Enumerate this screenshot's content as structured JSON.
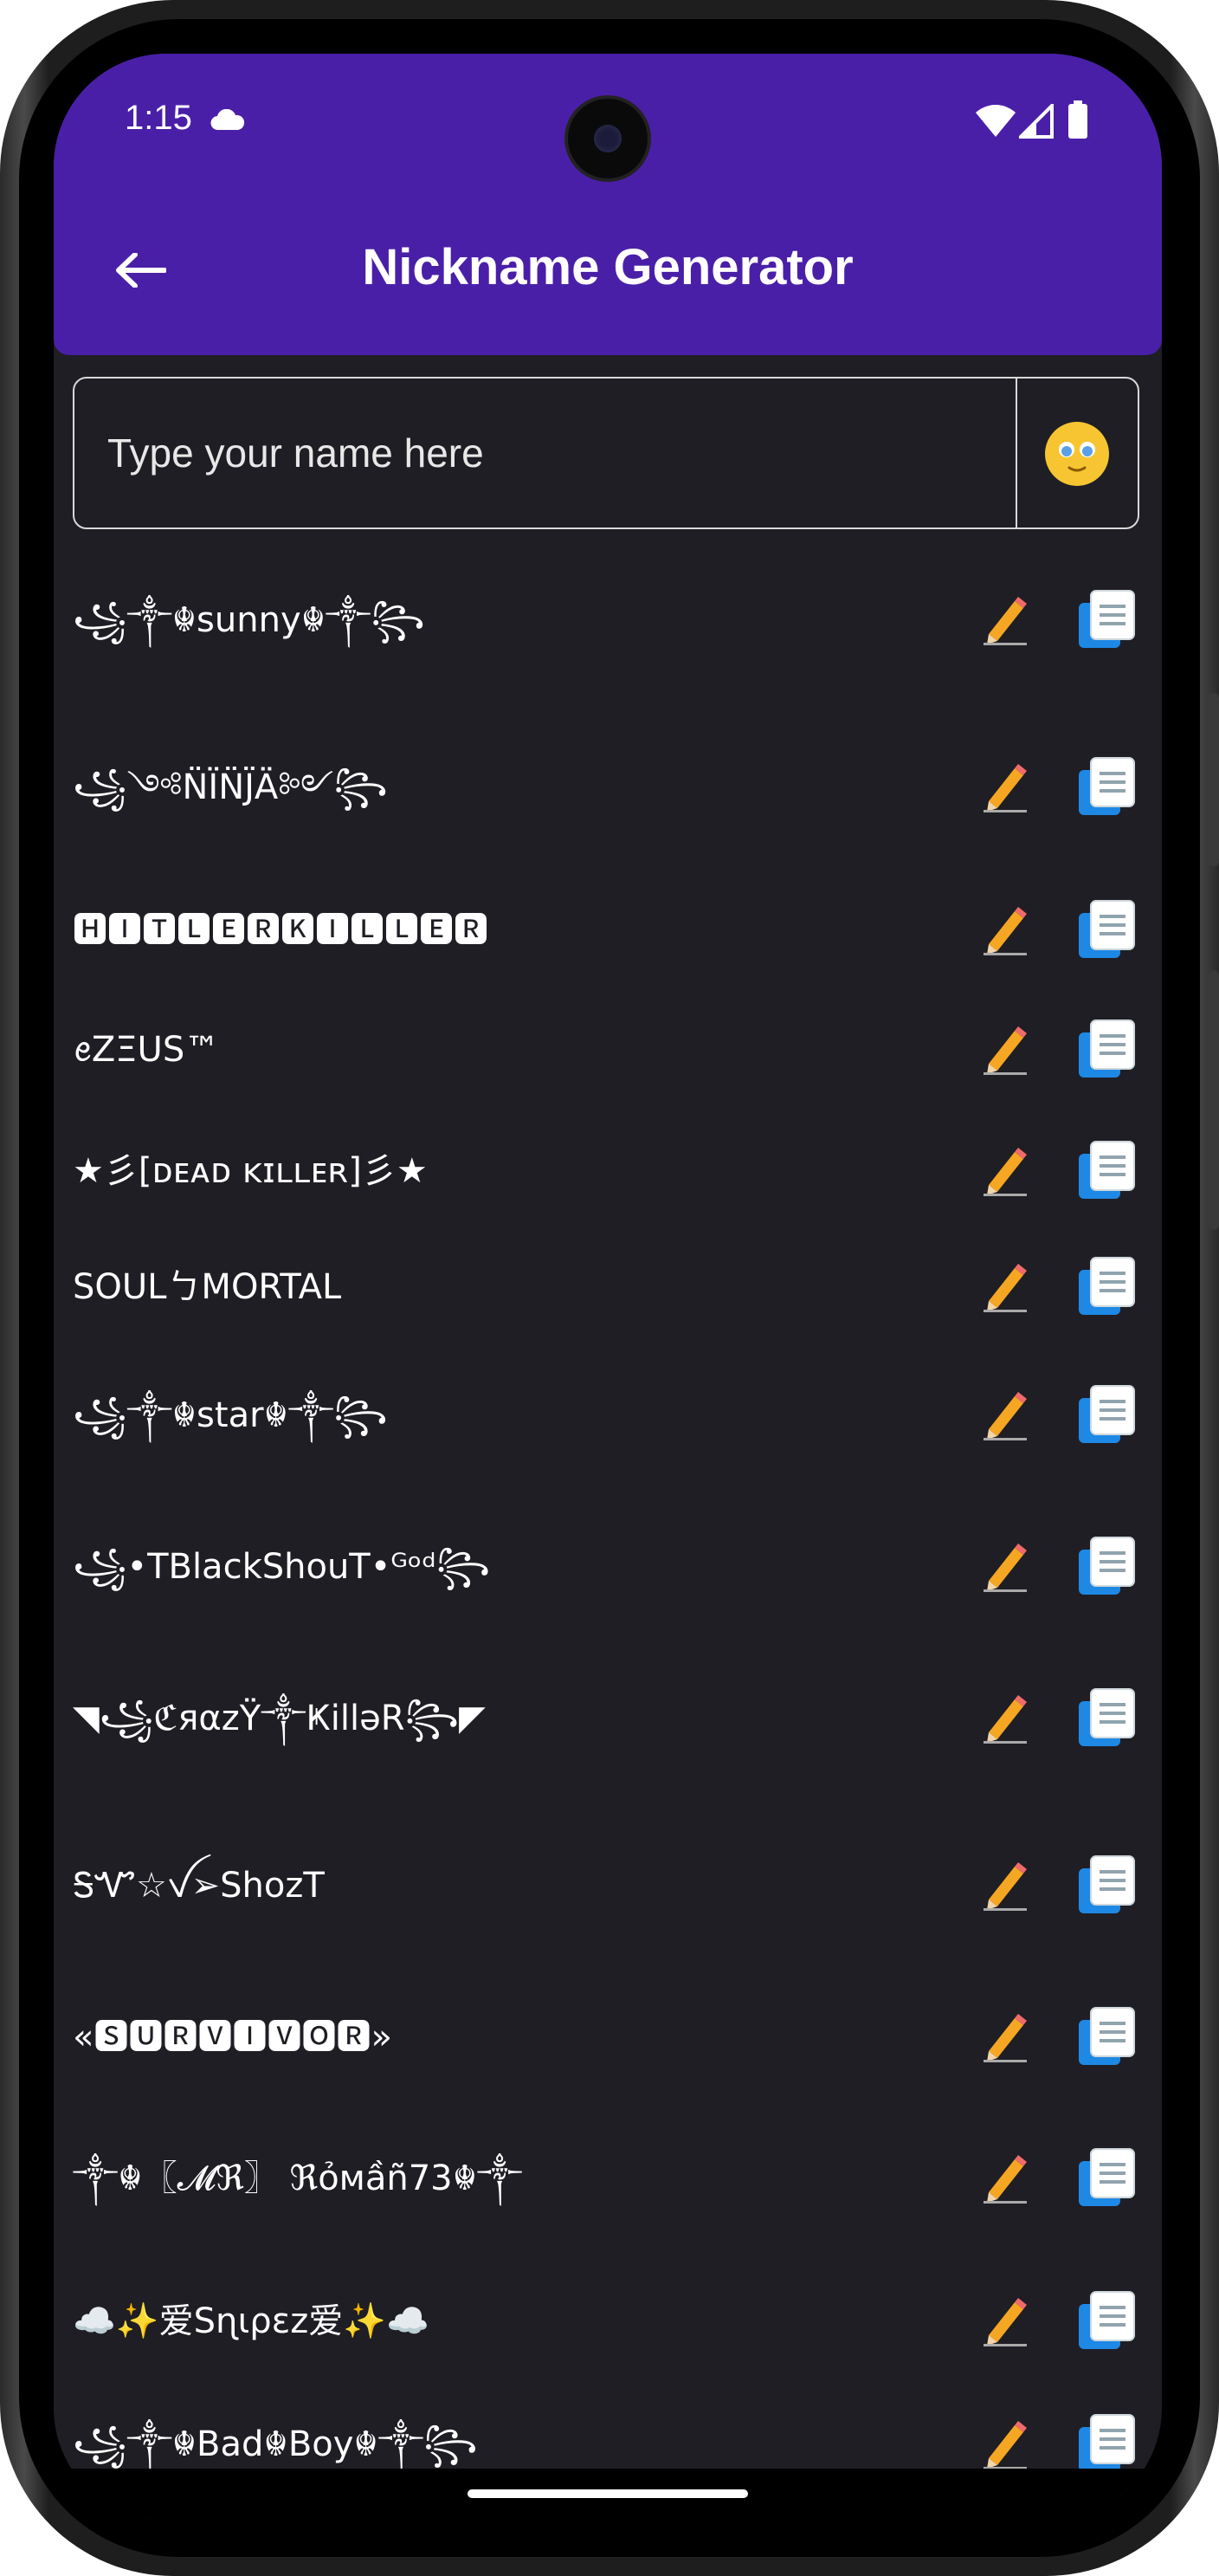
{
  "status_bar": {
    "time": "1:15",
    "icons": [
      "cloud-icon",
      "wifi-icon",
      "signal-icon",
      "battery-icon"
    ]
  },
  "app_bar": {
    "title": "Nickname Generator",
    "back_icon": "arrow-left-icon",
    "background": "#4a1fa8"
  },
  "name_input": {
    "placeholder": "Type your name here",
    "value": "",
    "emoji_icon": "emoji-face-icon"
  },
  "nicknames": [
    {
      "text": "꧁༒☬sunny☬༒꧂"
    },
    {
      "text": "꧁༺N̈ÏN̈J̈Ä༻꧂"
    },
    {
      "text": "🅷🅸🆃🅻🅴🆁🅺🅸🅻🅻🅴🆁"
    },
    {
      "text": "ꫀZΞUS™"
    },
    {
      "text": "★彡[ᴅᴇᴀᴅ ᴋɪʟʟᴇʀ]彡★"
    },
    {
      "text": "SOULㄅMORTAL"
    },
    {
      "text": "꧁༒☬star☬༒꧂"
    },
    {
      "text": "꧁•TBlackShouT•ᴳᵒᵈ꧂"
    },
    {
      "text": "◥꧁ℭяαzΫ༒ҜillǝR꧂◤"
    },
    {
      "text": "ᎦᏉ☆ꪜ➢ShozT"
    },
    {
      "text": "«🆂🆄🆁🆅🅸🆅🅾🆁»"
    },
    {
      "text": "༒☬〖𝓜ℜ〗 ℜỏмầñ73☬༒"
    },
    {
      "text": "☁️✨爱Sɳιρεz爱✨☁️"
    },
    {
      "text": "꧁༒☬Bad☬Boy☬༒꧂"
    }
  ],
  "row_actions": {
    "edit_icon": "pencil-icon",
    "copy_icon": "copy-icon",
    "copy_color": "#1e88e5"
  },
  "colors": {
    "screen_bg": "#1f1e24",
    "text": "#ffffff"
  }
}
